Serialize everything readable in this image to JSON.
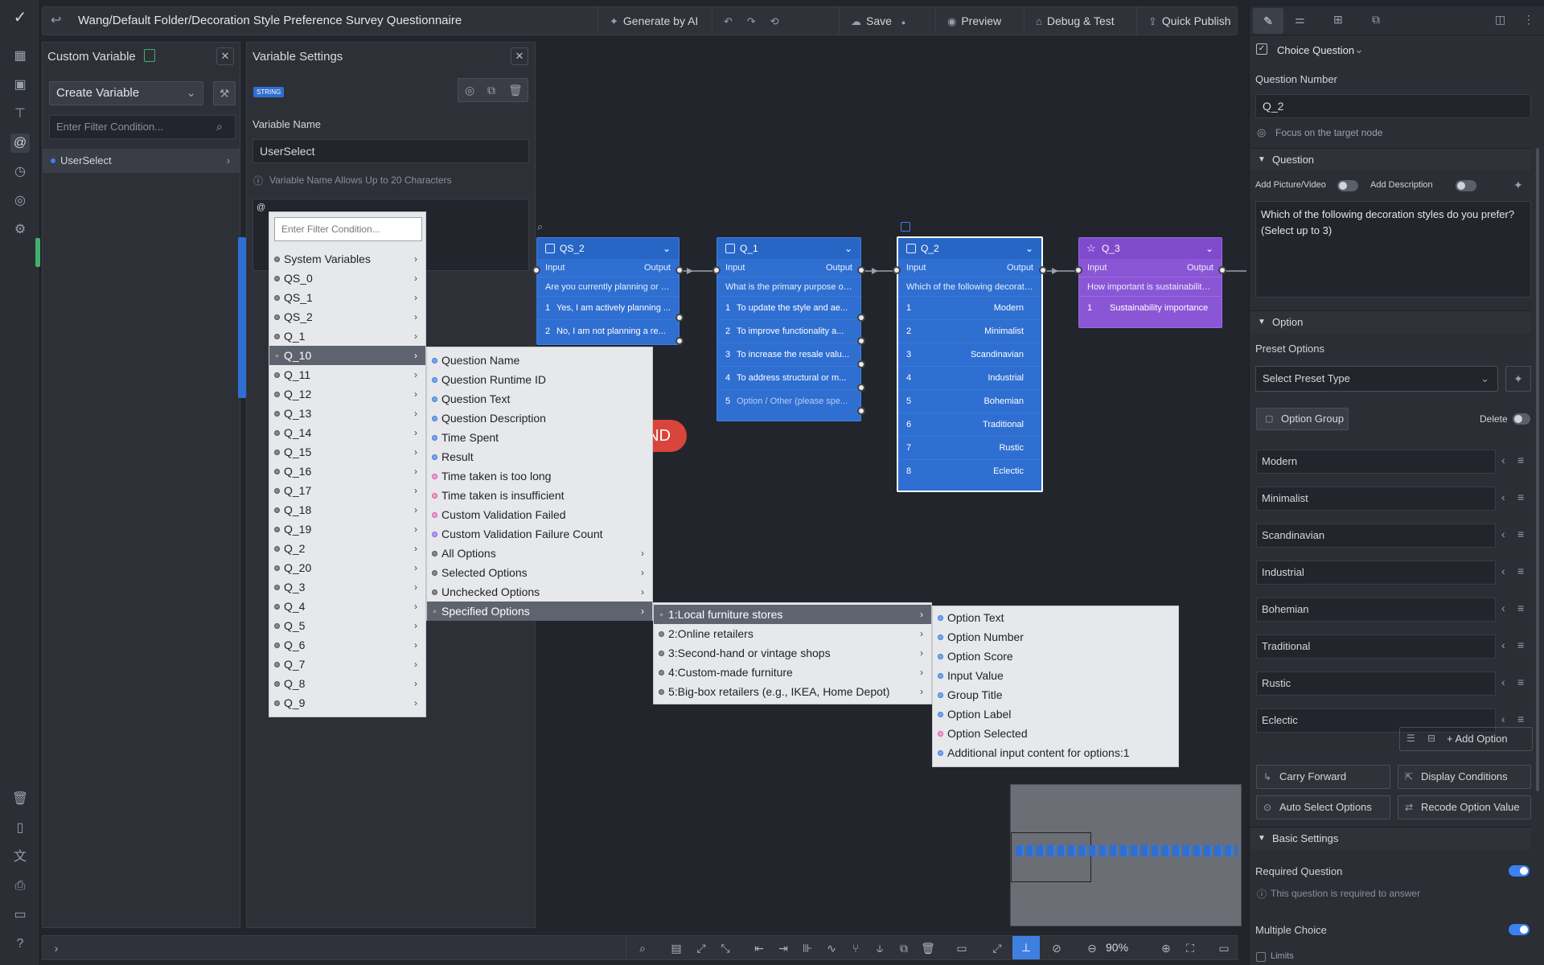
{
  "topbar": {
    "breadcrumb": "Wang/Default Folder/Decoration Style Preference Survey Questionnaire",
    "generate_ai": "Generate by AI",
    "save": "Save",
    "preview": "Preview",
    "debug_test": "Debug & Test",
    "quick_publish": "Quick Publish"
  },
  "custom_variable": {
    "title": "Custom Variable",
    "create_variable": "Create Variable",
    "filter_placeholder": "Enter Filter Condition...",
    "items": [
      {
        "label": "UserSelect"
      }
    ]
  },
  "variable_settings": {
    "title": "Variable Settings",
    "type_badge": "STRING",
    "name_label": "Variable Name",
    "name_value": "UserSelect",
    "name_hint": "Variable Name Allows Up to 20 Characters",
    "at_symbol": "@"
  },
  "var_menu": {
    "filter_placeholder": "Enter Filter Condition...",
    "items": [
      "System Variables",
      "QS_0",
      "QS_1",
      "QS_2",
      "Q_1",
      "Q_10",
      "Q_11",
      "Q_12",
      "Q_13",
      "Q_14",
      "Q_15",
      "Q_16",
      "Q_17",
      "Q_18",
      "Q_19",
      "Q_2",
      "Q_20",
      "Q_3",
      "Q_4",
      "Q_5",
      "Q_6",
      "Q_7",
      "Q_8",
      "Q_9"
    ],
    "selected": "Q_10"
  },
  "q10_menu": {
    "items": [
      {
        "label": "Question Name",
        "dot": "b",
        "sub": false
      },
      {
        "label": "Question Runtime ID",
        "dot": "b",
        "sub": false
      },
      {
        "label": "Question Text",
        "dot": "b",
        "sub": false
      },
      {
        "label": "Question Description",
        "dot": "b",
        "sub": false
      },
      {
        "label": "Time Spent",
        "dot": "b",
        "sub": false
      },
      {
        "label": "Result",
        "dot": "b",
        "sub": false
      },
      {
        "label": "Time taken is too long",
        "dot": "p",
        "sub": false
      },
      {
        "label": "Time taken is insufficient",
        "dot": "p",
        "sub": false
      },
      {
        "label": "Custom Validation Failed",
        "dot": "p",
        "sub": false
      },
      {
        "label": "Custom Validation Failure Count",
        "dot": "v",
        "sub": false
      },
      {
        "label": "All Options",
        "dot": "g",
        "sub": true
      },
      {
        "label": "Selected Options",
        "dot": "g",
        "sub": true
      },
      {
        "label": "Unchecked Options",
        "dot": "g",
        "sub": true
      },
      {
        "label": "Specified Options",
        "dot": "g",
        "sub": true
      }
    ],
    "selected": "Specified Options"
  },
  "specified_menu": {
    "items": [
      "1:Local furniture stores",
      "2:Online retailers",
      "3:Second-hand or vintage shops",
      "4:Custom-made furniture",
      "5:Big-box retailers (e.g., IKEA, Home Depot)"
    ],
    "selected": "1:Local furniture stores"
  },
  "option_prop_menu": {
    "items": [
      {
        "label": "Option Text",
        "dot": "b"
      },
      {
        "label": "Option Number",
        "dot": "b"
      },
      {
        "label": "Option Score",
        "dot": "b"
      },
      {
        "label": "Input Value",
        "dot": "b"
      },
      {
        "label": "Group Title",
        "dot": "b"
      },
      {
        "label": "Option Label",
        "dot": "b"
      },
      {
        "label": "Option Selected",
        "dot": "p"
      },
      {
        "label": "Additional input content for options:1",
        "dot": "b"
      }
    ]
  },
  "canvas": {
    "end_label": "ND",
    "io_input": "Input",
    "io_output": "Output",
    "nodes": [
      {
        "id": "QS_2",
        "question": "Are you currently planning or pr...",
        "options": [
          {
            "n": "1",
            "t": "Yes, I am actively planning ..."
          },
          {
            "n": "2",
            "t": "No, I am not planning a re..."
          }
        ]
      },
      {
        "id": "Q_1",
        "question": "What is the primary purpose of ...",
        "options": [
          {
            "n": "1",
            "t": "To update the style and ae..."
          },
          {
            "n": "2",
            "t": "To improve functionality a..."
          },
          {
            "n": "3",
            "t": "To increase the resale valu..."
          },
          {
            "n": "4",
            "t": "To address structural or m..."
          },
          {
            "n": "5",
            "t": "Option / Other (please spe..."
          }
        ]
      },
      {
        "id": "Q_2",
        "question": "Which of the following decorati...",
        "options": [
          {
            "n": "1",
            "t": "Modern"
          },
          {
            "n": "2",
            "t": "Minimalist"
          },
          {
            "n": "3",
            "t": "Scandinavian"
          },
          {
            "n": "4",
            "t": "Industrial"
          },
          {
            "n": "5",
            "t": "Bohemian"
          },
          {
            "n": "6",
            "t": "Traditional"
          },
          {
            "n": "7",
            "t": "Rustic"
          },
          {
            "n": "8",
            "t": "Eclectic"
          }
        ]
      },
      {
        "id": "Q_3",
        "question": "How important is sustainability i...",
        "options": [
          {
            "n": "1",
            "t": "Sustainability importance"
          }
        ]
      }
    ]
  },
  "right_panel": {
    "question_type": "Choice Question",
    "question_number_label": "Question Number",
    "question_number": "Q_2",
    "focus_target": "Focus on the target node",
    "question_section": "Question",
    "add_picture": "Add Picture/Video",
    "add_description": "Add Description",
    "question_text": "Which of the following decoration styles do you prefer? (Select up to 3)",
    "option_section": "Option",
    "preset_options_label": "Preset Options",
    "preset_select": "Select Preset Type",
    "option_group": "Option Group",
    "delete": "Delete",
    "options": [
      "Modern",
      "Minimalist",
      "Scandinavian",
      "Industrial",
      "Bohemian",
      "Traditional",
      "Rustic",
      "Eclectic"
    ],
    "add_option": "Add Option",
    "carry_forward": "Carry Forward",
    "display_conditions": "Display Conditions",
    "auto_select": "Auto Select Options",
    "recode_option": "Recode Option Value",
    "basic_settings": "Basic Settings",
    "required_question": "Required Question",
    "required_hint": "This question is required to answer",
    "multiple_choice": "Multiple Choice",
    "limits": "Limits"
  },
  "bottombar": {
    "zoom": "90%"
  },
  "colors": {
    "accent": "#3b82f0",
    "node_blue": "#2f6fd1",
    "node_purple": "#8b56d6",
    "end_red": "#d9443b"
  }
}
